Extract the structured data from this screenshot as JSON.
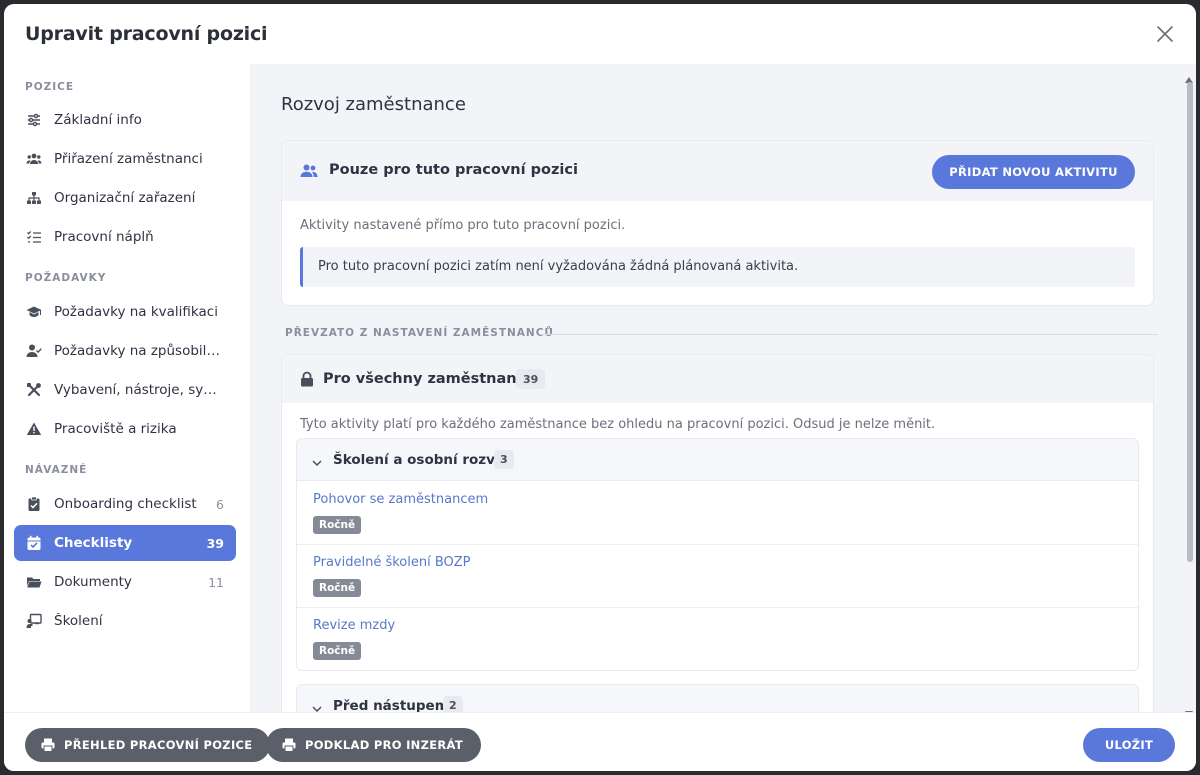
{
  "header": {
    "title": "Upravit pracovní pozici"
  },
  "sidebar": {
    "sections": [
      {
        "label": "POZICE"
      },
      {
        "label": "POŽADAVKY"
      },
      {
        "label": "NÁVAZNÉ"
      }
    ],
    "items": [
      {
        "label": "Základní info",
        "icon": "sliders-icon"
      },
      {
        "label": "Přiřazení zaměstnanci",
        "icon": "users-icon"
      },
      {
        "label": "Organizační zařazení",
        "icon": "sitemap-icon"
      },
      {
        "label": "Pracovní náplň",
        "icon": "checklist-icon"
      },
      {
        "label": "Požadavky na kvalifikaci",
        "icon": "graduation-cap-icon"
      },
      {
        "label": "Požadavky na způsobilost",
        "icon": "user-check-icon"
      },
      {
        "label": "Vybavení, nástroje, systé…",
        "icon": "tools-icon"
      },
      {
        "label": "Pracoviště a rizika",
        "icon": "warning-icon"
      },
      {
        "label": "Onboarding checklist",
        "icon": "clipboard-check-icon",
        "count": "6"
      },
      {
        "label": "Checklisty",
        "icon": "calendar-check-icon",
        "count": "39",
        "active": true
      },
      {
        "label": "Dokumenty",
        "icon": "folder-icon",
        "count": "11"
      },
      {
        "label": "Školení",
        "icon": "chalkboard-teacher-icon"
      }
    ]
  },
  "main": {
    "title": "Rozvoj zaměstnance",
    "position_card": {
      "title": "Pouze pro tuto pracovní pozici",
      "add_button": "PŘIDAT NOVOU AKTIVITU",
      "description": "Aktivity nastavené přímo pro tuto pracovní pozici.",
      "empty_notice": "Pro tuto pracovní pozici zatím není vyžadována žádná plánovaná aktivita."
    },
    "inherited_label": "PŘEVZATO Z NASTAVENÍ ZAMĚSTNANCŮ",
    "all_card": {
      "title": "Pro všechny zaměstnance",
      "count": "39",
      "description": "Tyto aktivity platí pro každého zaměstnance bez ohledu na pracovní pozici. Odsud je nelze měnit.",
      "groups": [
        {
          "title": "Školení a osobní rozvoj",
          "count": "3",
          "items": [
            {
              "name": "Pohovor se zaměstnancem",
              "frequency": "Ročně"
            },
            {
              "name": "Pravidelné školení BOZP",
              "frequency": "Ročně"
            },
            {
              "name": "Revize mzdy",
              "frequency": "Ročně"
            }
          ]
        },
        {
          "title": "Před nástupem",
          "count": "2"
        }
      ]
    }
  },
  "footer": {
    "overview_button": "PŘEHLED PRACOVNÍ POZICE",
    "ad_button": "PODKLAD PRO INZERÁT",
    "save_button": "ULOŽIT"
  },
  "colors": {
    "accent": "#5a78dc",
    "link": "#5a78c8",
    "dark_button": "#5b5f6a",
    "tag": "#858a96"
  }
}
